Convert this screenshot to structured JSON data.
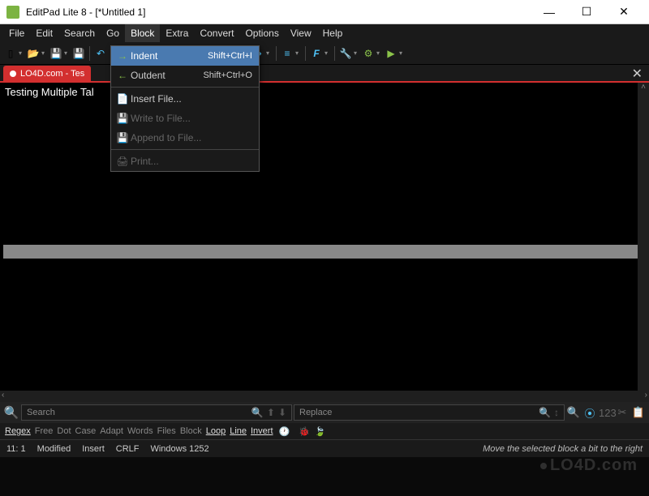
{
  "window": {
    "title": "EditPad Lite 8 - [*Untitled 1]",
    "minimize": "—",
    "maximize": "☐",
    "close": "✕"
  },
  "menubar": [
    "File",
    "Edit",
    "Search",
    "Go",
    "Block",
    "Extra",
    "Convert",
    "Options",
    "View",
    "Help"
  ],
  "menubar_active": "Block",
  "dropdown": {
    "items": [
      {
        "icon": "→",
        "label": "Indent",
        "shortcut": "Shift+Ctrl+I",
        "hi": true
      },
      {
        "icon": "←",
        "label": "Outdent",
        "shortcut": "Shift+Ctrl+O"
      },
      {
        "sep": true
      },
      {
        "icon": "📄",
        "label": "Insert File..."
      },
      {
        "icon": "💾",
        "label": "Write to File...",
        "disabled": true
      },
      {
        "icon": "💾",
        "label": "Append to File...",
        "disabled": true
      },
      {
        "sep": true
      },
      {
        "icon": "🖨",
        "label": "Print...",
        "disabled": true
      }
    ]
  },
  "tab": {
    "label": "LO4D.com - Tes",
    "close": "✕"
  },
  "editor": {
    "text": "Testing Multiple Tal"
  },
  "search": {
    "search_placeholder": "Search",
    "replace_placeholder": "Replace"
  },
  "options": [
    "Regex",
    "Free",
    "Dot",
    "Case",
    "Adapt",
    "Words",
    "Files",
    "Block",
    "Loop",
    "Line",
    "Invert"
  ],
  "options_on": [
    "Regex",
    "Loop",
    "Line",
    "Invert"
  ],
  "status": {
    "pos": "11: 1",
    "modified": "Modified",
    "insert": "Insert",
    "eol": "CRLF",
    "encoding": "Windows 1252",
    "hint": "Move the selected block a bit to the right"
  },
  "watermark": "LO4D.com"
}
